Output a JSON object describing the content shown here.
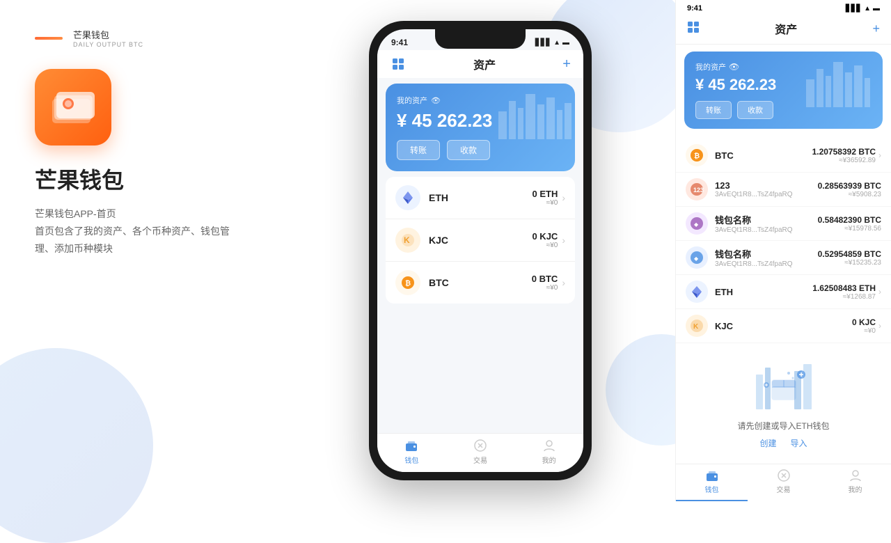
{
  "brand": {
    "name": "芒果钱包",
    "subtitle": "DAILY OUTPUT BTC"
  },
  "app": {
    "title": "芒果钱包",
    "desc_line1": "芒果钱包APP-首页",
    "desc_line2": "首页包含了我的资产、各个币种资产、钱包管",
    "desc_line3": "理、添加币种模块"
  },
  "phone": {
    "status_time": "9:41",
    "header_title": "资产",
    "add_btn": "+",
    "asset_card": {
      "label": "我的资产",
      "amount": "¥ 45 262.23",
      "transfer_btn": "转账",
      "receive_btn": "收款"
    },
    "coins": [
      {
        "id": "eth",
        "symbol": "ETH",
        "amount": "0 ETH",
        "cny": "≈¥0",
        "color": "#ecf3ff",
        "icon_color": "#627eea"
      },
      {
        "id": "kjc",
        "symbol": "KJC",
        "amount": "0 KJC",
        "cny": "≈¥0",
        "color": "#fff3e0",
        "icon_color": "#f0a030"
      },
      {
        "id": "btc",
        "symbol": "BTC",
        "amount": "0 BTC",
        "cny": "≈¥0",
        "color": "#fff8ec",
        "icon_color": "#f7931a"
      }
    ],
    "nav": [
      {
        "label": "钱包",
        "active": true
      },
      {
        "label": "交易",
        "active": false
      },
      {
        "label": "我的",
        "active": false
      }
    ]
  },
  "right": {
    "status_time": "9:41",
    "header_title": "资产",
    "asset_card": {
      "label": "我的资产",
      "amount": "¥ 45 262.23",
      "transfer_btn": "转账",
      "receive_btn": "收款"
    },
    "coins": [
      {
        "id": "btc",
        "symbol": "BTC",
        "name": "BTC",
        "addr": "",
        "amount": "1.20758392 BTC",
        "cny": "≈¥36592.89",
        "color": "#fff8ec",
        "icon_color": "#f7931a"
      },
      {
        "id": "r123",
        "symbol": "123",
        "name": "123",
        "addr": "3AvEQt1R8...TsZ4fpaRQ",
        "amount": "0.28563939 BTC",
        "cny": "≈¥5908.23",
        "color": "#ffe8e0",
        "icon_color": "#e05030"
      },
      {
        "id": "wallet1",
        "symbol": "钱包名称",
        "name": "钱包名称",
        "addr": "3AvEQt1R8...TsZ4fpaRQ",
        "amount": "0.58482390 BTC",
        "cny": "≈¥15978.56",
        "color": "#f3e8ff",
        "icon_color": "#9b59b6"
      },
      {
        "id": "wallet2",
        "symbol": "钱包名称",
        "name": "钱包名称",
        "addr": "3AvEQt1R8...TsZ4fpaRQ",
        "amount": "0.52954859 BTC",
        "cny": "≈¥15235.23",
        "color": "#e8f0ff",
        "icon_color": "#4a90e2"
      },
      {
        "id": "eth",
        "symbol": "ETH",
        "name": "ETH",
        "addr": "",
        "amount": "1.62508483 ETH",
        "cny": "≈¥1268.87",
        "color": "#ecf3ff",
        "icon_color": "#627eea"
      },
      {
        "id": "kjc",
        "symbol": "KJC",
        "name": "KJC",
        "addr": "",
        "amount": "0 KJC",
        "cny": "≈¥0",
        "color": "#fff3e0",
        "icon_color": "#f0a030"
      }
    ],
    "eth_create": {
      "text": "请先创建或导入ETH钱包",
      "create_btn": "创建",
      "import_btn": "导入"
    },
    "nav": [
      {
        "label": "钱包",
        "active": true
      },
      {
        "label": "交易",
        "active": false
      },
      {
        "label": "我的",
        "active": false
      }
    ]
  }
}
